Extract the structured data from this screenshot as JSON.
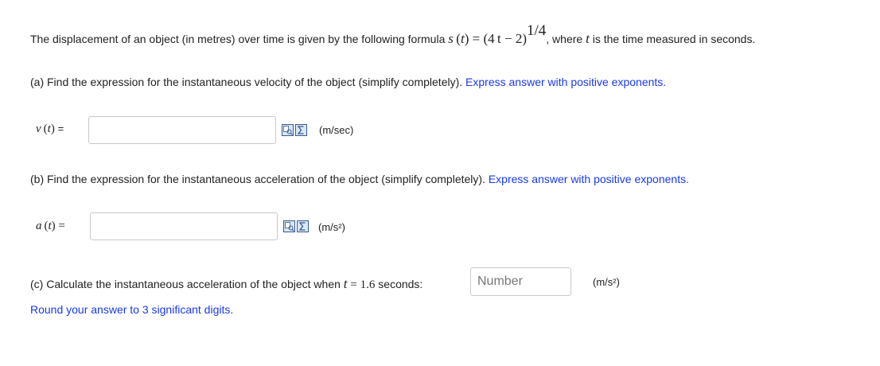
{
  "intro": {
    "text": "The displacement of an object (in metres) over time is given by the following formula",
    "formula_lhs": "s",
    "formula_var": "t",
    "formula_rhs": "= (4 t − 2)",
    "formula_exp": "1/4",
    "comma": ",",
    "where_text": "where",
    "where_var": "t",
    "where_rest": "is the time measured in seconds."
  },
  "part_a": {
    "prompt": "(a) Find the expression for the instantaneous velocity of the object (simplify completely).",
    "hint": "Express answer with positive exponents.",
    "label_func": "v",
    "label_var": "t",
    "label_eq": "=",
    "value": "",
    "units": "(m/sec)"
  },
  "part_b": {
    "prompt": "(b) Find the expression for the instantaneous acceleration of the object (simplify completely).",
    "hint": "Express answer with positive exponents.",
    "label_func": "a",
    "label_var": "t",
    "label_eq": "=",
    "value": "",
    "units": "(m/s²)"
  },
  "part_c": {
    "prompt": "(c) Calculate the instantaneous acceleration of the object when",
    "var": "t",
    "eq_value": "= 1.6",
    "seconds": "seconds:",
    "placeholder": "Number",
    "value": "",
    "units": "(m/s²)",
    "round_note": "Round your answer to 3 significant digits."
  },
  "icons": [
    "preview-icon",
    "equation-editor-icon"
  ],
  "colors": {
    "hint_blue": "#1a3ae8",
    "text": "#222222",
    "field_border": "#c9c9c9"
  }
}
